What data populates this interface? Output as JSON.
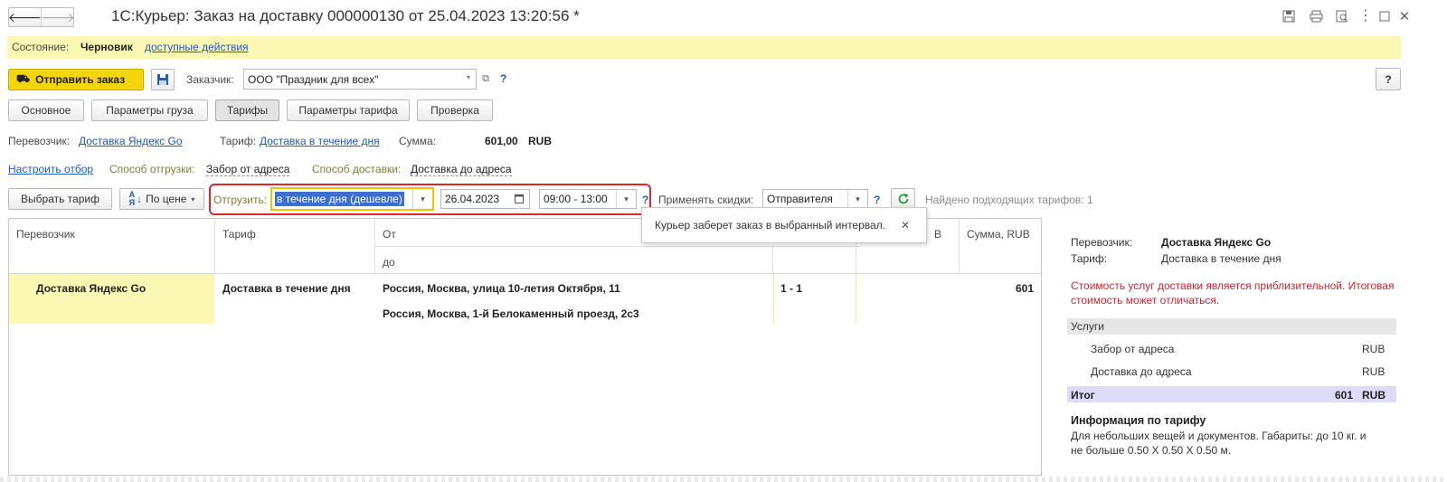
{
  "window": {
    "title": "1С:Курьер: Заказ на доставку 000000130 от 25.04.2023 13:20:56 *"
  },
  "status_bar": {
    "label": "Состояние:",
    "value": "Черновик",
    "actions_link": "доступные действия"
  },
  "toolbar": {
    "send_button": "Отправить заказ",
    "customer_label": "Заказчик:",
    "customer_value": "ООО \"Праздник для всех\"",
    "help_button": "?"
  },
  "tabs": [
    "Основное",
    "Параметры груза",
    "Тарифы",
    "Параметры тарифа",
    "Проверка"
  ],
  "summary": {
    "carrier_label": "Перевозчик:",
    "carrier_value": "Доставка Яндекс Go",
    "tariff_label": "Тариф:",
    "tariff_value": "Доставка в течение дня",
    "sum_label": "Сумма:",
    "sum_value": "601,00",
    "currency": "RUB"
  },
  "filters": {
    "setup_link": "Настроить отбор",
    "shipment_label": "Способ отгрузки:",
    "shipment_value": "Забор от адреса",
    "delivery_label": "Способ доставки:",
    "delivery_value": "Доставка до адреса"
  },
  "controls": {
    "choose_tariff": "Выбрать тариф",
    "sort_button": "По цене",
    "ship_label": "Отгрузить:",
    "ship_value": "в течение дня (дешевле)",
    "date_value": "26.04.2023",
    "time_value": "09:00 - 13:00",
    "discount_label": "Применять скидки:",
    "discount_value": "Отправителя",
    "found_text": "Найдено подходящих тарифов: 1"
  },
  "tooltip": {
    "text": "Курьер заберет заказ в выбранный интервал."
  },
  "table": {
    "headers": {
      "carrier": "Перевозчик",
      "tariff": "Тариф",
      "from": "От",
      "to": "до",
      "days_partial": "В",
      "sum": "Сумма, RUB"
    },
    "rows": [
      {
        "carrier": "Доставка Яндекс Go",
        "tariff": "Доставка в течение дня",
        "from": "Россия, Москва, улица 10-летия Октября, 11",
        "to": "Россия, Москва, 1-й Белокаменный проезд, 2с3",
        "days": "1 - 1",
        "sum": "601"
      }
    ]
  },
  "details": {
    "carrier_label": "Перевозчик:",
    "carrier_value": "Доставка Яндекс Go",
    "tariff_label": "Тариф:",
    "tariff_value": "Доставка в течение дня",
    "warning_line1": "Стоимость услуг доставки является приблизительной. Итоговая",
    "warning_line2": "стоимость может отличаться.",
    "services_header": "Услуги",
    "services": [
      {
        "name": "Забор от адреса",
        "currency": "RUB"
      },
      {
        "name": "Доставка до адреса",
        "currency": "RUB"
      }
    ],
    "total_label": "Итог",
    "total_value": "601",
    "total_currency": "RUB",
    "info_title": "Информация по тарифу",
    "info_line1": "Для небольших вещей и документов. Габариты: до 10 кг. и",
    "info_line2": "не больше 0.50 Х 0.50 Х 0.50 м."
  },
  "colors": {
    "status_bg": "#fbf8b4",
    "send_button": "#f4d40a",
    "highlight_row": "#fbf8b4",
    "selection": "#3b6fd4",
    "link": "#1d5ac4",
    "warning": "#d2262e",
    "callout_border": "#e0262b"
  }
}
